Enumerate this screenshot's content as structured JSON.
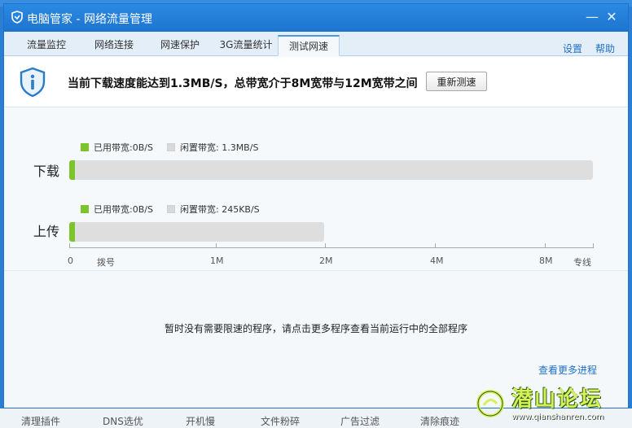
{
  "window": {
    "title": "电脑管家 - 网络流量管理",
    "minimize_glyph": "—",
    "close_glyph": "✕"
  },
  "tabs": [
    {
      "label": "流量监控",
      "active": false
    },
    {
      "label": "网络连接",
      "active": false
    },
    {
      "label": "网速保护",
      "active": false
    },
    {
      "label": "3G流量统计",
      "active": false
    },
    {
      "label": "测试网速",
      "active": true
    }
  ],
  "tab_links": {
    "settings": "设置",
    "help": "帮助"
  },
  "banner": {
    "message": "当前下载速度能达到1.3MB/S，总带宽介于8M宽带与12M宽带之间",
    "retest_button": "重新测速",
    "icon": "shield-info-icon"
  },
  "download": {
    "label": "下载",
    "used_label": "已用带宽:0B/S",
    "idle_label": "闲置带宽: 1.3MB/S"
  },
  "upload": {
    "label": "上传",
    "used_label": "已用带宽:0B/S",
    "idle_label": "闲置带宽: 245KB/S"
  },
  "axis": {
    "ticks": [
      "0",
      "拨号",
      "1M",
      "2M",
      "4M",
      "8M",
      "专线"
    ]
  },
  "hint": "暂时没有需要限速的程序，请点击更多程序查看当前运行中的全部程序",
  "more_link": "查看更多进程",
  "colors": {
    "used": "#7cc42b",
    "idle": "#dedede",
    "title_bar": "#1d74cf",
    "link": "#1e6fc6"
  },
  "taskbar": [
    "清理插件",
    "DNS选优",
    "开机慢",
    "文件粉碎",
    "广告过滤",
    "清除痕迹"
  ],
  "watermark": {
    "text": "潜山论坛",
    "url": "www.qianshanren.com"
  }
}
